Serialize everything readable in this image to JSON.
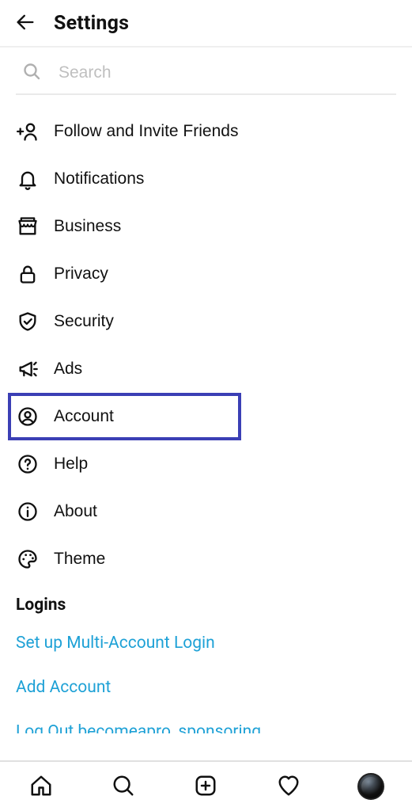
{
  "header": {
    "title": "Settings"
  },
  "search": {
    "placeholder": "Search"
  },
  "items": [
    {
      "icon": "follow-invite-icon",
      "label": "Follow and Invite Friends"
    },
    {
      "icon": "bell-icon",
      "label": "Notifications"
    },
    {
      "icon": "store-icon",
      "label": "Business"
    },
    {
      "icon": "lock-icon",
      "label": "Privacy"
    },
    {
      "icon": "shield-icon",
      "label": "Security"
    },
    {
      "icon": "megaphone-icon",
      "label": "Ads"
    },
    {
      "icon": "person-circle-icon",
      "label": "Account",
      "highlight": true
    },
    {
      "icon": "help-circle-icon",
      "label": "Help"
    },
    {
      "icon": "info-circle-icon",
      "label": "About"
    },
    {
      "icon": "palette-icon",
      "label": "Theme"
    }
  ],
  "logins": {
    "title": "Logins",
    "links": [
      "Set up Multi-Account Login",
      "Add Account",
      "Log Out becomeapro_sponsoring"
    ]
  },
  "nav": {
    "items": [
      "home-icon",
      "search-icon",
      "add-post-icon",
      "heart-icon",
      "avatar"
    ]
  }
}
